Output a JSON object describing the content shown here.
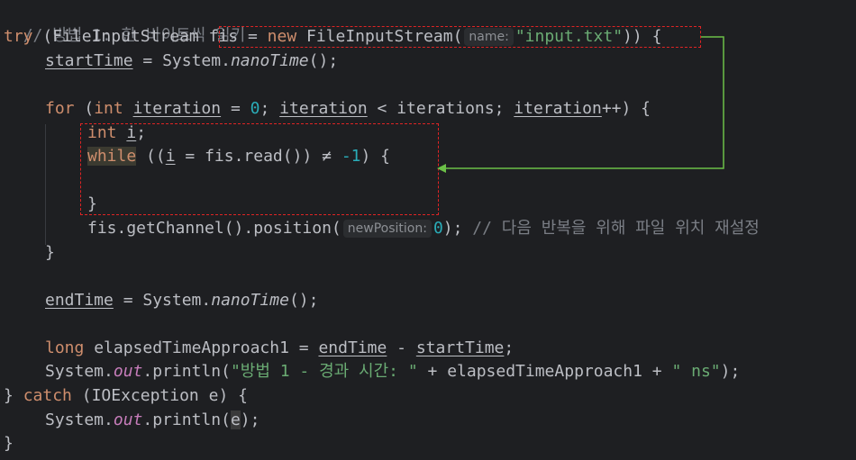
{
  "code": {
    "comment1": "// 방법 1: 한 바이트씩 읽기",
    "try_kw": "try",
    "fis_class": "FileInputStream",
    "fis_var": "fis",
    "new_kw": "new",
    "hint_name": "name:",
    "input_file": "\"input.txt\"",
    "start_time": "startTime",
    "system": "System",
    "nano_time": "nanoTime",
    "for_kw": "for",
    "int_kw": "int",
    "iteration": "iteration",
    "zero": "0",
    "iterations": "iterations",
    "i_var": "i",
    "while_kw": "while",
    "read_call": "fis.read()",
    "neq": "≠",
    "minus_one": "-1",
    "get_channel": "fis.getChannel()",
    "position": ".position(",
    "hint_new_position": "newPosition:",
    "comment2": "// 다음 반복을 위해 파일 위치 재설정",
    "end_time": "endTime",
    "long_kw": "long",
    "elapsed": "elapsedTimeApproach1",
    "out": "out",
    "println": "println",
    "msg_str": "\"방법 1 - 경과 시간: \"",
    "ns_str": "\" ns\"",
    "catch_kw": "catch",
    "ioexception": "IOException",
    "e_var": "e"
  },
  "colors": {
    "background": "#1e1f22",
    "keyword": "#cf8e6d",
    "number": "#2aacb8",
    "string": "#6aab73",
    "annotation_box": "#e02424",
    "arrow": "#6bbf47"
  }
}
